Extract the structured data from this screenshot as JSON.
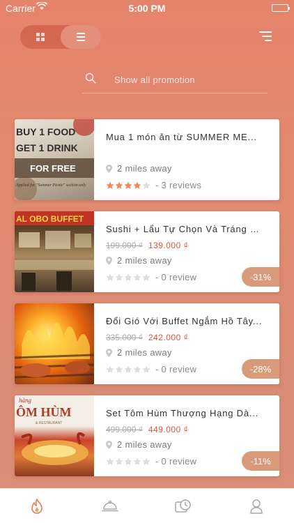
{
  "status_bar": {
    "carrier": "Carrier",
    "time": "5:00 PM"
  },
  "search": {
    "placeholder": "Show all promotion"
  },
  "view_toggle": {
    "selected": "list"
  },
  "promotions": [
    {
      "title": "Mua 1 món ăn  từ SUMMER ME...",
      "distance": "2 miles away",
      "rating": 4,
      "reviews": "- 3 reviews",
      "thumb_text": [
        "BUY 1 FOOD",
        "GET 1 DRINK",
        "FOR FREE",
        "Applied for \"Summer Picnic\" section only"
      ]
    },
    {
      "title": "Sushi + Lẩu Tự Chọn Và Tráng M...",
      "old_price": "199.000 ₫",
      "new_price": "139.000 ₫",
      "distance": "2 miles away",
      "rating": 0,
      "reviews": "- 0 review",
      "discount": "-31%",
      "thumb_text": [
        "AL OBO BUFFET"
      ]
    },
    {
      "title": "Đổi Gió Với Buffet Ngắm Hồ Tây...",
      "old_price": "335.000 ₫",
      "new_price": "242.000 ₫",
      "distance": "2 miles away",
      "rating": 0,
      "reviews": "- 0 review",
      "discount": "-28%"
    },
    {
      "title": "Set Tôm Hùm Thượng Hạng Dà...",
      "old_price": "499.000 ₫",
      "new_price": "449.000 ₫",
      "distance": "2 miles away",
      "rating": 0,
      "reviews": "- 0 review",
      "discount": "-11%",
      "thumb_text": [
        "hàng",
        "ÔM HÙM",
        "& RESTAURANT"
      ]
    }
  ],
  "tab_bar": {
    "items": [
      {
        "icon": "flame-icon",
        "active": true
      },
      {
        "icon": "cloche-icon",
        "active": false
      },
      {
        "icon": "history-icon",
        "active": false
      },
      {
        "icon": "user-icon",
        "active": false
      }
    ]
  },
  "colors": {
    "accent": "#e5533b",
    "star_filled": "#f08a5d",
    "star_empty": "#dcdcdc",
    "discount": "#d99a7a"
  }
}
